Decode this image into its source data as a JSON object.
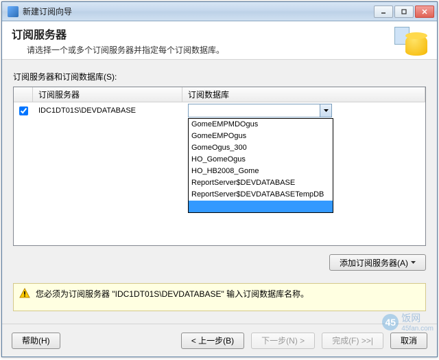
{
  "window": {
    "title": "新建订阅向导"
  },
  "header": {
    "title": "订阅服务器",
    "subtitle": "请选择一个或多个订阅服务器并指定每个订阅数据库。"
  },
  "section_label": "订阅服务器和订阅数据库(S):",
  "grid": {
    "col_server": "订阅服务器",
    "col_db": "订阅数据库",
    "rows": [
      {
        "checked": true,
        "server": "IDC1DT01S\\DEVDATABASE",
        "db": ""
      }
    ]
  },
  "dropdown_options": [
    "GomeEMPMDOgus",
    "GomeEMPOgus",
    "GomeOgus_300",
    "HO_GomeOgus",
    "HO_HB2008_Gome",
    "ReportServer$DEVDATABASE",
    "ReportServer$DEVDATABASETempDB",
    ""
  ],
  "dropdown_selected_index": 7,
  "buttons": {
    "add_server": "添加订阅服务器(A)",
    "help": "帮助(H)",
    "back": "< 上一步(B)",
    "next": "下一步(N) >",
    "finish": "完成(F) >>|",
    "cancel": "取消"
  },
  "message": {
    "text_pre": "您必须为订阅服务器 \"",
    "server": "IDC1DT01S\\DEVDATABASE",
    "text_post": "\" 输入订阅数据库名称。"
  },
  "watermark": "饭网",
  "watermark_sub": "45fan.com"
}
